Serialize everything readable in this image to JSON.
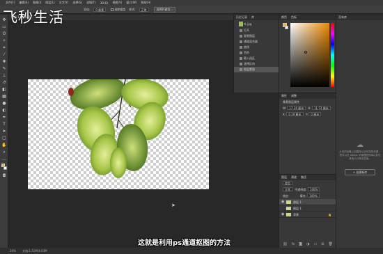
{
  "watermark": "飞秒生活",
  "subtitle": "这就是利用ps通道抠图的方法",
  "menubar": {
    "items": [
      "文件(F)",
      "编辑(E)",
      "图像(I)",
      "图层(L)",
      "文字(Y)",
      "选择(S)",
      "滤镜(T)",
      "3D(D)",
      "视图(V)",
      "窗口(W)",
      "帮助(H)"
    ]
  },
  "options": {
    "feather_label": "羽化:",
    "feather_value": "0 像素",
    "antialias": "消除锯齿",
    "style_label": "样式:",
    "style_value": "正常",
    "refine": "选择并遮住..."
  },
  "document": {
    "tab": "图层 1, RGB/8#"
  },
  "status": {
    "zoom": "50%",
    "doc": "文档:1.51M/4.03M"
  },
  "history": {
    "tabs": [
      "历史记录",
      "库"
    ],
    "snapshot": "叶.jpg",
    "items": [
      "打开",
      "复制图层",
      "通道混合器",
      "曲线",
      "色阶",
      "载入选区",
      "选择反向",
      "图层蒙版"
    ],
    "selected_index": 7
  },
  "colorpanel": {
    "tabs": [
      "颜色",
      "色板"
    ],
    "fg": "#e9b44c"
  },
  "properties": {
    "tabs": [
      "属性",
      "调整"
    ],
    "title": "像素图层属性",
    "w_label": "W:",
    "w_value": "17.24 厘米",
    "h_label": "H:",
    "h_value": "11.72 厘米",
    "x_label": "X:",
    "x_value": "0.19 厘米",
    "y_label": "Y:",
    "y_value": "0 厘米"
  },
  "layers": {
    "tabs": [
      "图层",
      "通道",
      "路径"
    ],
    "kind_label": "类型",
    "blend_mode": "正常",
    "opacity_label": "不透明度:",
    "opacity": "100%",
    "lock_label": "锁定:",
    "fill_label": "填充:",
    "fill": "100%",
    "items": [
      {
        "name": "图层 1",
        "selected": true,
        "locked": false
      },
      {
        "name": "图层 1",
        "selected": false,
        "locked": false
      },
      {
        "name": "背景",
        "selected": false,
        "locked": true
      }
    ]
  },
  "libraries": {
    "title": "没有库",
    "text": "从你的设备上创建库以访问您的资源，您可以在 Adobe 中管理您的库以及与其他人分享这些库。",
    "button": "+ 创建新库"
  }
}
